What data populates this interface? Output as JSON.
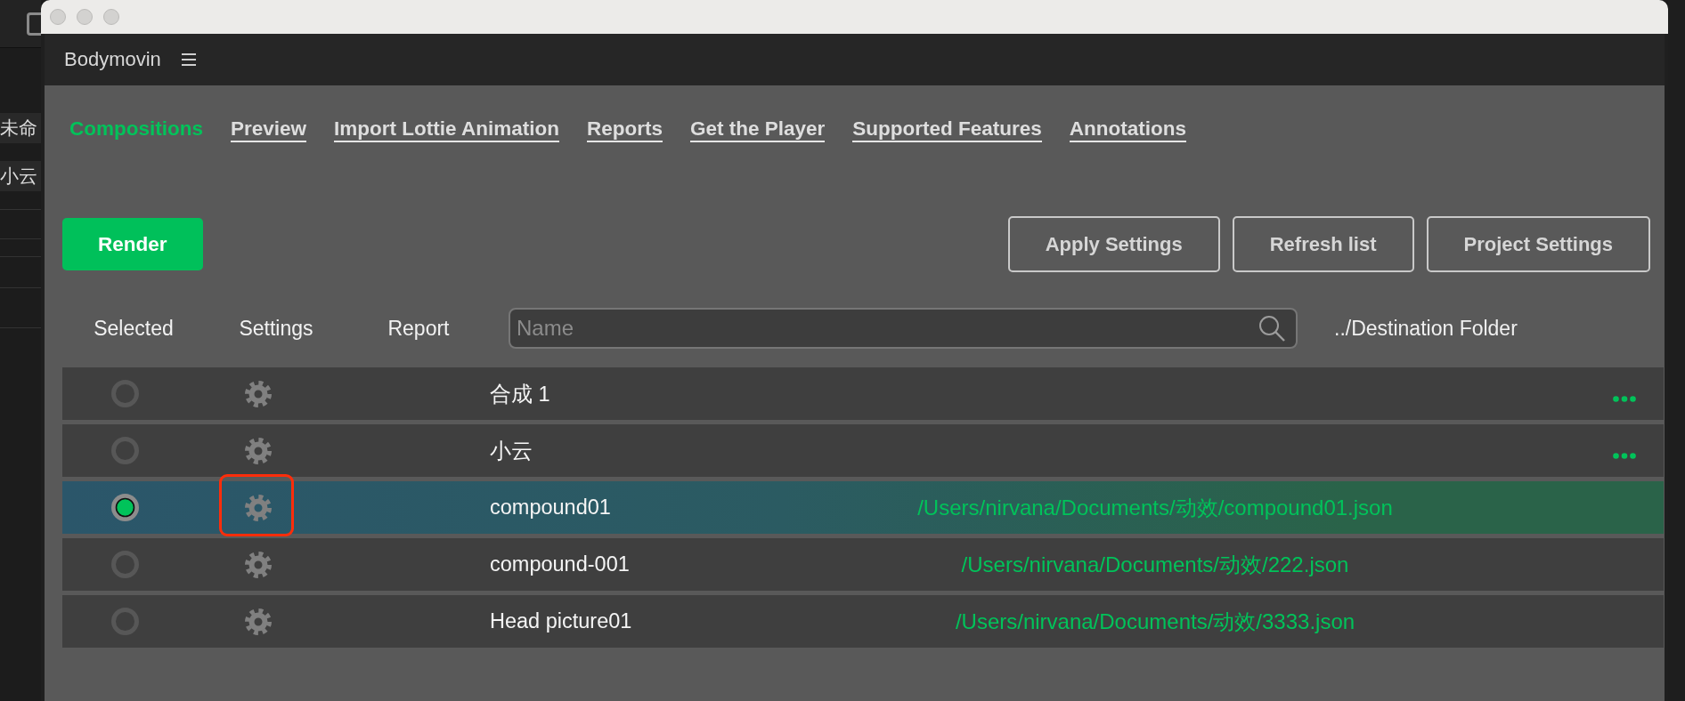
{
  "background_app": {
    "items": [
      "未命",
      "小云"
    ]
  },
  "panel": {
    "title": "Bodymovin"
  },
  "tabs": [
    {
      "label": "Compositions",
      "selected": true
    },
    {
      "label": "Preview",
      "selected": false
    },
    {
      "label": "Import Lottie Animation",
      "selected": false
    },
    {
      "label": "Reports",
      "selected": false
    },
    {
      "label": "Get the Player",
      "selected": false
    },
    {
      "label": "Supported Features",
      "selected": false
    },
    {
      "label": "Annotations",
      "selected": false
    }
  ],
  "toolbar": {
    "render": "Render",
    "buttons": [
      "Apply Settings",
      "Refresh list",
      "Project Settings"
    ]
  },
  "list_header": {
    "columns": [
      "Selected",
      "Settings",
      "Report"
    ],
    "search": {
      "placeholder": "Name"
    },
    "destination": "../Destination Folder"
  },
  "rows": [
    {
      "name": "合成 1",
      "selected": false,
      "highlighted": false
    },
    {
      "name": "小云",
      "selected": false,
      "highlighted": false
    },
    {
      "name": "compound01",
      "selected": true,
      "highlighted": true,
      "destination": "/Users/nirvana/Documents/动效/compound01.json"
    },
    {
      "name": "compound-001",
      "selected": false,
      "highlighted": false,
      "destination": "/Users/nirvana/Documents/动效/222.json"
    },
    {
      "name": "Head picture01",
      "selected": false,
      "highlighted": false,
      "destination": "/Users/nirvana/Documents/动效/3333.json"
    }
  ]
}
